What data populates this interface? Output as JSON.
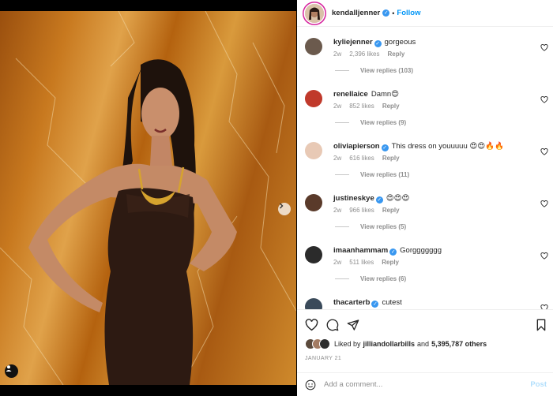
{
  "post": {
    "author": "kendalljenner",
    "separator": "•",
    "follow_label": "Follow",
    "carousel": {
      "slides": 4,
      "active": 0
    }
  },
  "comments": [
    {
      "user": "kyliejenner",
      "verified": true,
      "text": "gorgeous",
      "age": "2w",
      "likes": "2,396 likes",
      "reply": "Reply",
      "replies": "View replies (103)",
      "avatar_color": "#6b5a4d"
    },
    {
      "user": "renellaice",
      "verified": false,
      "text": "Damn😍",
      "age": "2w",
      "likes": "852 likes",
      "reply": "Reply",
      "replies": "View replies (9)",
      "avatar_color": "#c0392b"
    },
    {
      "user": "oliviapierson",
      "verified": true,
      "text": "This dress on youuuuu 😍😍🔥🔥",
      "age": "2w",
      "likes": "616 likes",
      "reply": "Reply",
      "replies": "View replies (11)",
      "avatar_color": "#e8c9b5"
    },
    {
      "user": "justineskye",
      "verified": true,
      "text": "😍😍😍",
      "age": "2w",
      "likes": "966 likes",
      "reply": "Reply",
      "replies": "View replies (5)",
      "avatar_color": "#5a3a2a"
    },
    {
      "user": "imaanhammam",
      "verified": true,
      "text": "Gorggggggg",
      "age": "2w",
      "likes": "511 likes",
      "reply": "Reply",
      "replies": "View replies (6)",
      "avatar_color": "#2b2b2b"
    },
    {
      "user": "thacarterb",
      "verified": true,
      "text": "cutest",
      "age": "",
      "likes": "",
      "reply": "",
      "replies": "",
      "avatar_color": "#3a4a5a"
    }
  ],
  "likes": {
    "prefix": "Liked by",
    "user": "jilliandollarbills",
    "middle": "and",
    "count": "5,395,787 others"
  },
  "date": "JANUARY 21",
  "add_comment": {
    "placeholder": "Add a comment...",
    "post_label": "Post"
  },
  "colors": {
    "accent": "#0095f6",
    "verified": "#3897f0",
    "post_disabled": "#b2dffc"
  }
}
